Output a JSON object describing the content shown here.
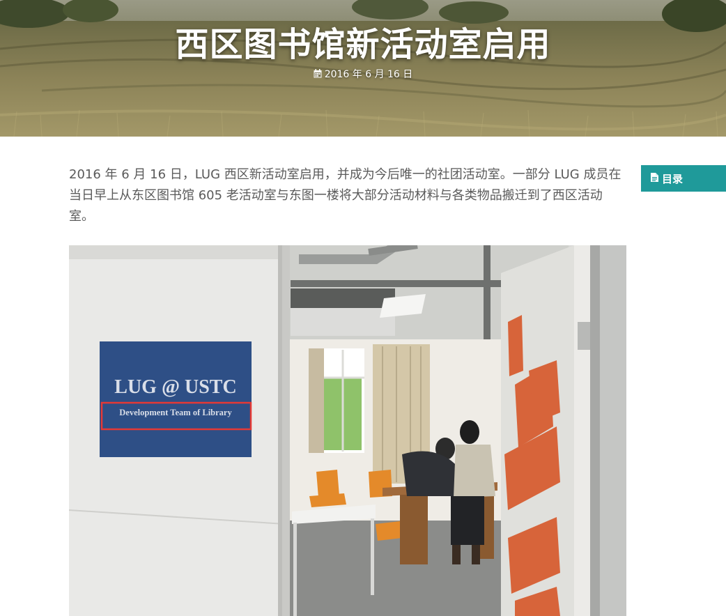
{
  "header": {
    "title": "西区图书馆新活动室启用",
    "date": "2016 年 6 月 16 日",
    "date_icon": "calendar-icon"
  },
  "sidebar": {
    "toc_label": "目录",
    "toc_icon": "document-icon"
  },
  "article": {
    "intro": "2016 年 6 月 16 日，LUG 西区新活动室启用，并成为今后唯一的社团活动室。一部分 LUG 成员在当日早上从东区图书馆 605 老活动室与东图一楼将大部分活动材料与各类物品搬迁到了西区活动室。",
    "photo": {
      "sign_title": "LUG @ USTC",
      "sign_subtitle": "Development Team of Library"
    }
  },
  "colors": {
    "accent": "#1f9a9a",
    "body_text": "#5a5a5a",
    "sign_blue": "#2e4f86",
    "highlight_box": "#e53935"
  }
}
